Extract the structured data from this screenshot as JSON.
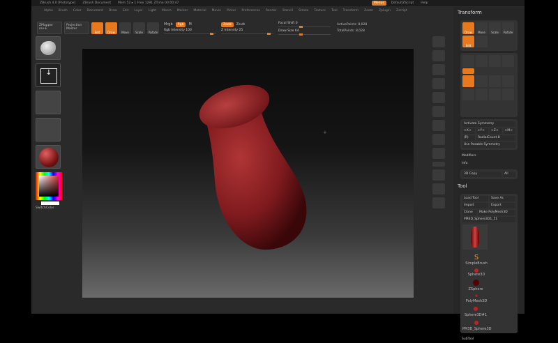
{
  "titlebar": {
    "app": "ZBrush 4.0 [Prototype]",
    "doc": "ZBrush Document",
    "stats": "Mem 52 ▸ 1 Free 1291 ZTime 00:00:47"
  },
  "menus": [
    "Alpha",
    "Brush",
    "Color",
    "Document",
    "Draw",
    "Edit",
    "Layer",
    "Light",
    "Macro",
    "Marker",
    "Material",
    "Movie",
    "Picker",
    "Preferences",
    "Render",
    "Stencil",
    "Stroke",
    "Texture",
    "Tool",
    "Transform",
    "Zoom",
    "Zplugin",
    "Zscript"
  ],
  "right_menu": {
    "menus": "Menus",
    "script": "DefaultZScript",
    "help": "Help"
  },
  "toolbar": {
    "zmapper": "ZMapper",
    "zmapper_sub": "rev-E",
    "projection": "Projection",
    "projection_sub": "Master",
    "edit": "Edit",
    "draw": "Draw",
    "move": "Move",
    "scale": "Scale",
    "rotate": "Rotate",
    "rgb": "Rgb",
    "rgb_label": "Mrgb",
    "m": "M",
    "rgb_intensity": "Rgb Intensity 100",
    "zadd": "Zadd",
    "zsub": "Zsub",
    "z_intensity": "Z Intensity 25",
    "focal_shift": "Focal Shift 0",
    "draw_size": "Draw Size 64",
    "active_points": "ActivePoints: 8,028",
    "total_points": "TotalPoints: 8,028"
  },
  "left_shelf": {
    "switch_color": "SwitchColor"
  },
  "transform": {
    "title": "Transform",
    "buttons": [
      "Draw",
      "Move",
      "Scale",
      "Rotate",
      "Edit"
    ],
    "sym": "Activate Symmetry",
    "axes": [
      ">X<",
      ">Y<",
      ">Z<",
      ">M<"
    ],
    "r": "(R)",
    "radial": "RadialCount 8",
    "posable": "Use Posable Symmetry"
  },
  "modifiers": "Modifiers",
  "info": "Info",
  "copy": {
    "label": "3D Copy",
    "all": "All"
  },
  "tool": {
    "title": "Tool",
    "load": "Load Tool",
    "save": "Save As",
    "import": "Import",
    "export": "Export",
    "clone": "Clone",
    "polymesh": "Make PolyMesh3D",
    "current": "PM3D_Sphere3D1_51",
    "items": [
      "SimpleBrush",
      "Sphere3D",
      "ZSphere",
      "PolyMesh3D",
      "Sphere3D#1",
      "PM3D_Sphere3D"
    ],
    "subtool": "SubTool"
  },
  "colors": {
    "accent": "#e8791d",
    "clay": "#8a1e22"
  }
}
